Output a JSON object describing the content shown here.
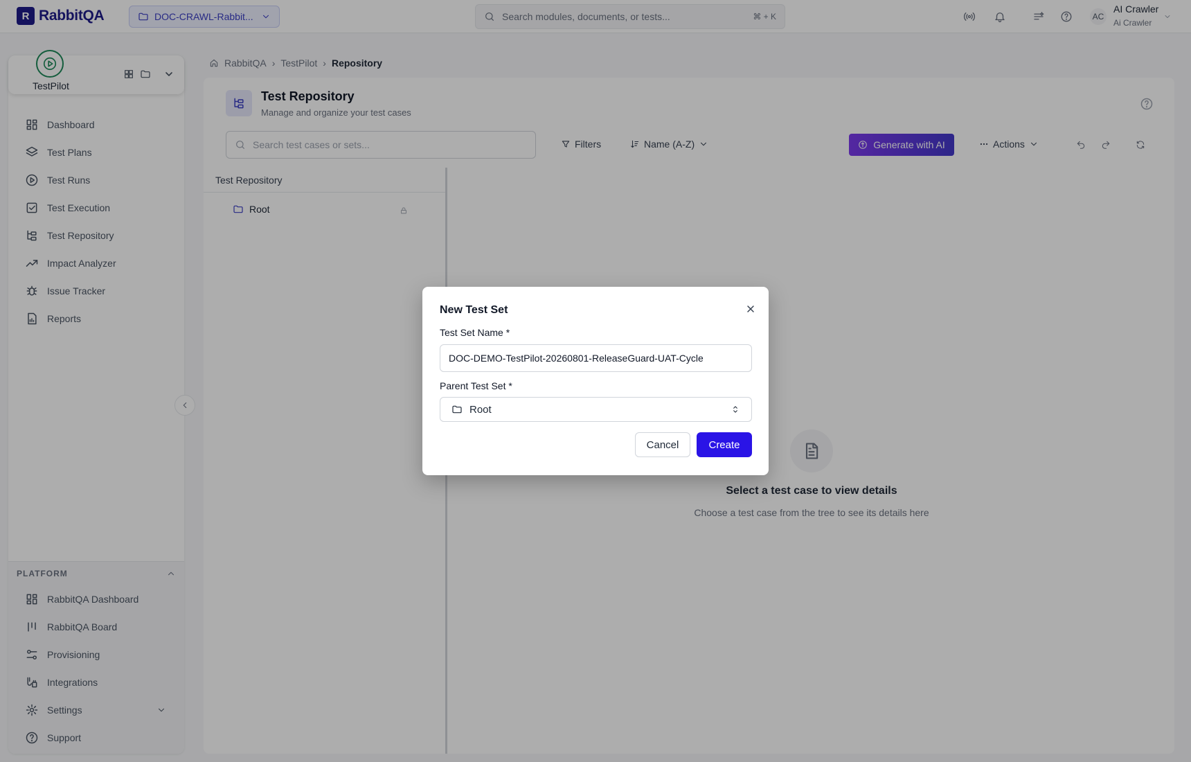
{
  "app": {
    "name": "RabbitQA",
    "logo_letter": "R"
  },
  "project": {
    "label": "DOC-CRAWL-Rabbit..."
  },
  "global_search": {
    "placeholder": "Search modules, documents, or tests...",
    "shortcut": "⌘ + K"
  },
  "user": {
    "initials": "AC",
    "name": "AI Crawler",
    "subtitle": "Ai Crawler"
  },
  "module": {
    "name": "TestPilot"
  },
  "nav": {
    "items": [
      {
        "label": "Dashboard",
        "icon": "grid-icon"
      },
      {
        "label": "Test Plans",
        "icon": "layers-icon"
      },
      {
        "label": "Test Runs",
        "icon": "play-circle-icon"
      },
      {
        "label": "Test Execution",
        "icon": "check-square-icon"
      },
      {
        "label": "Test Repository",
        "icon": "tree-icon"
      },
      {
        "label": "Impact Analyzer",
        "icon": "trend-icon"
      },
      {
        "label": "Issue Tracker",
        "icon": "bug-icon"
      },
      {
        "label": "Reports",
        "icon": "report-icon"
      }
    ]
  },
  "platform": {
    "heading": "PLATFORM",
    "items": [
      {
        "label": "RabbitQA Dashboard",
        "icon": "grid-icon"
      },
      {
        "label": "RabbitQA Board",
        "icon": "board-icon"
      },
      {
        "label": "Provisioning",
        "icon": "sliders-icon"
      },
      {
        "label": "Integrations",
        "icon": "plug-icon"
      },
      {
        "label": "Settings",
        "icon": "gear-icon"
      },
      {
        "label": "Support",
        "icon": "help-icon"
      }
    ]
  },
  "breadcrumb": {
    "home": "RabbitQA",
    "module": "TestPilot",
    "current": "Repository"
  },
  "repository": {
    "title": "Test Repository",
    "subtitle": "Manage and organize your test cases",
    "search_placeholder": "Search test cases or sets...",
    "filters_label": "Filters",
    "sort_label": "Name (A-Z)",
    "ai_label": "Generate with AI",
    "actions_label": "Actions",
    "tree_heading": "Test Repository",
    "tree_root": "Root",
    "empty_title": "Select a test case to view details",
    "empty_subtitle": "Choose a test case from the tree to see its details here"
  },
  "dialog": {
    "title": "New Test Set",
    "name_label": "Test Set Name *",
    "name_value": "DOC-DEMO-TestPilot-20260801-ReleaseGuard-UAT-Cycle",
    "parent_label": "Parent Test Set *",
    "parent_value": "Root",
    "cancel_label": "Cancel",
    "create_label": "Create"
  },
  "colors": {
    "brand": "#1e1b8a",
    "primary": "#2a14e6",
    "module_accent": "#1f8a5b",
    "ai_gradient_start": "#7c3aed"
  }
}
